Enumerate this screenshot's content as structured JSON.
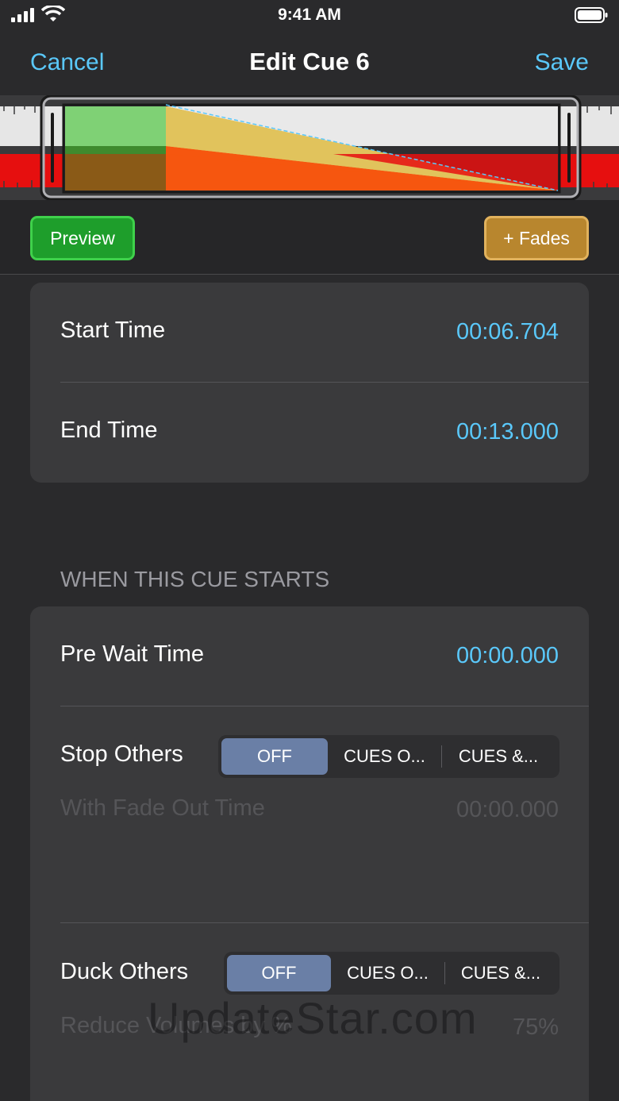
{
  "status_bar": {
    "time": "9:41 AM"
  },
  "nav": {
    "cancel": "Cancel",
    "title": "Edit Cue 6",
    "save": "Save"
  },
  "toolbar": {
    "preview": "Preview",
    "fades": "+ Fades"
  },
  "timing": {
    "start_label": "Start Time",
    "start_value": "00:06.704",
    "end_label": "End Time",
    "end_value": "00:13.000"
  },
  "section": {
    "header": "WHEN THIS CUE STARTS"
  },
  "cue_start": {
    "pre_wait_label": "Pre Wait Time",
    "pre_wait_value": "00:00.000",
    "stop_others_label": "Stop Others",
    "stop_others_options": [
      "OFF",
      "CUES O...",
      "CUES &..."
    ],
    "stop_others_selected": "OFF",
    "fade_out_label": "With Fade Out Time",
    "fade_out_value": "00:00.000",
    "duck_others_label": "Duck Others",
    "duck_others_options": [
      "OFF",
      "CUES O...",
      "CUES &..."
    ],
    "duck_others_selected": "OFF",
    "reduce_label": "Reduce Volumes by %",
    "reduce_value": "75%"
  },
  "watermark": "UpdateStar.com",
  "colors": {
    "accent": "#5ac8fa",
    "preview": "#1e9e2b",
    "fades": "#b8862e",
    "segment_active": "#6a7fa6"
  }
}
